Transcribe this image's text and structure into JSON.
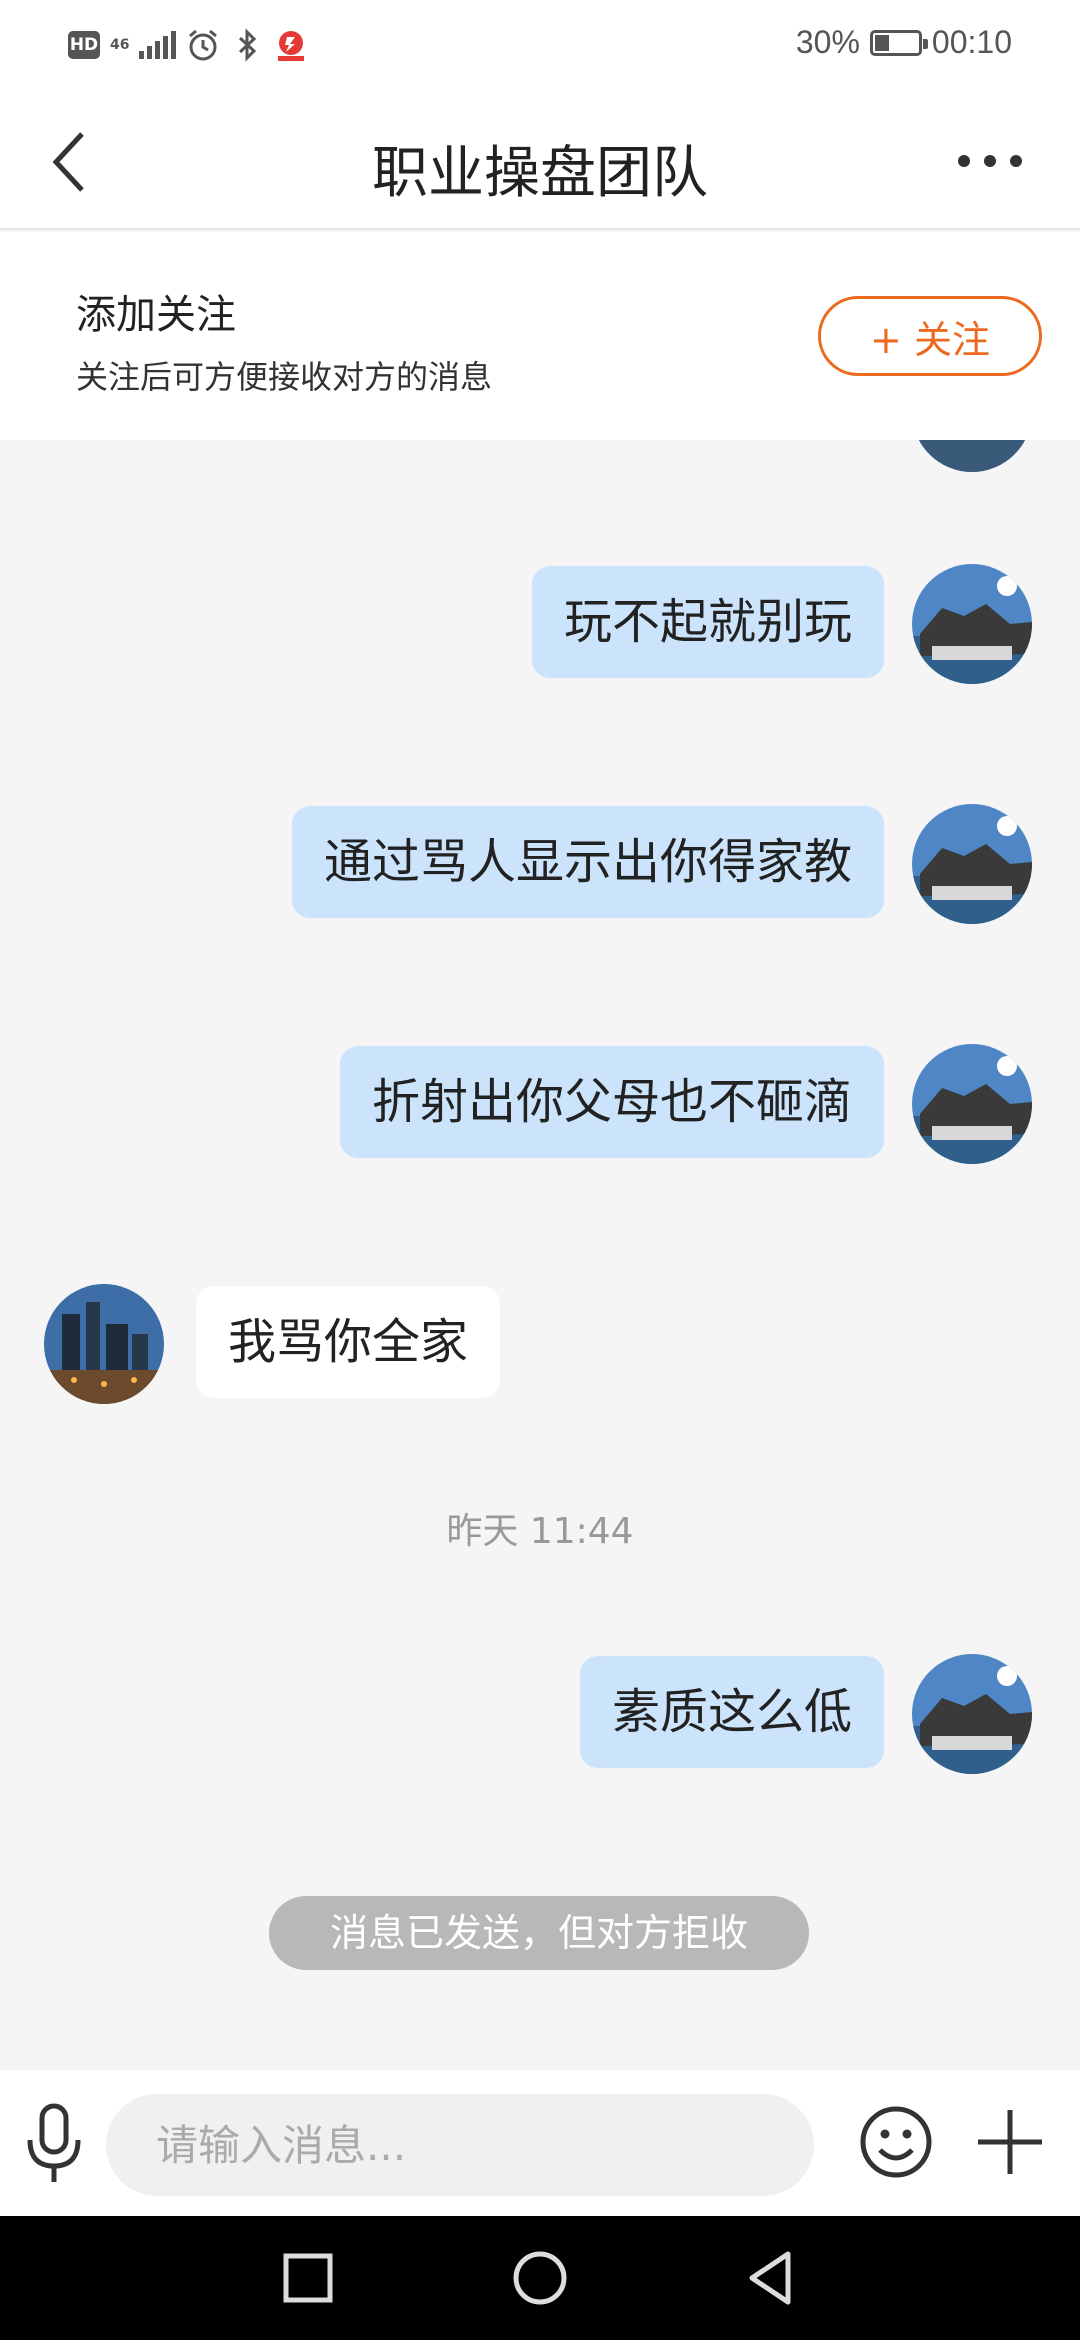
{
  "status_bar": {
    "hd_label": "HD",
    "network_label": "46",
    "battery_percent": "30%",
    "battery_level": 0.3,
    "time": "00:10",
    "icons": [
      "signal-icon",
      "alarm-icon",
      "bluetooth-icon",
      "app-notification-icon",
      "battery-icon"
    ]
  },
  "header": {
    "title": "职业操盘团队",
    "back_icon": "chevron-left-icon",
    "more_icon": "more-dots-icon"
  },
  "follow_banner": {
    "title": "添加关注",
    "subtitle": "关注后可方便接收对方的消息",
    "button_label": "+ 关注",
    "accent_color": "#ec6a1f"
  },
  "messages": [
    {
      "side": "right",
      "text": "玩不起就别玩"
    },
    {
      "side": "right",
      "text": "通过骂人显示出你得家教"
    },
    {
      "side": "right",
      "text": "折射出你父母也不砸滴"
    },
    {
      "side": "left",
      "text": "我骂你全家"
    },
    {
      "type": "timestamp",
      "text": "昨天 11:44"
    },
    {
      "side": "right",
      "text": "素质这么低"
    },
    {
      "type": "notice",
      "text": "消息已发送，但对方拒收"
    }
  ],
  "colors": {
    "my_bubble": "#cce4fb",
    "their_bubble": "#ffffff",
    "chat_background": "#f5f5f5"
  },
  "input_bar": {
    "placeholder": "请输入消息...",
    "value": "",
    "mic_icon": "microphone-icon",
    "emoji_icon": "emoji-icon",
    "plus_icon": "plus-icon"
  },
  "nav_bar": {
    "icons": [
      "recents-square-icon",
      "home-circle-icon",
      "back-triangle-icon"
    ]
  }
}
